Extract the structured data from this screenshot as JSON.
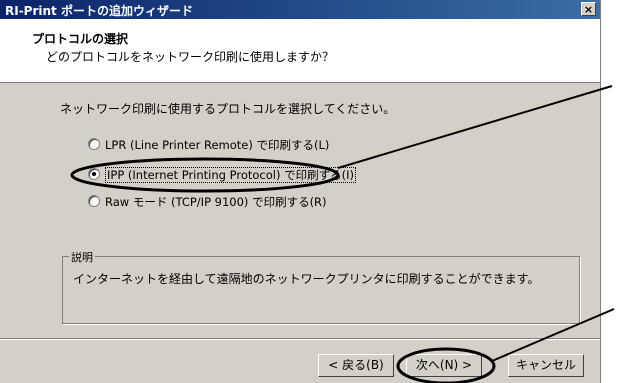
{
  "window": {
    "title": "RI-Print ポートの追加ウィザード",
    "close_label": "×"
  },
  "header": {
    "title": "プロトコルの選択",
    "subtitle": "どのプロトコルをネットワーク印刷に使用しますか？"
  },
  "main": {
    "intro": "ネットワーク印刷に使用するプロトコルを選択してください。",
    "options": [
      {
        "label": "LPR (Line Printer Remote) で印刷する(L)",
        "selected": false
      },
      {
        "label": "IPP (Internet Printing Protocol) で印刷する(I)",
        "selected": true
      },
      {
        "label": "Raw モード (TCP/IP 9100) で印刷する(R)",
        "selected": false
      }
    ],
    "description": {
      "legend": "説明",
      "text": "インターネットを経由して遠隔地のネットワークプリンタに印刷することができます。"
    }
  },
  "buttons": {
    "back": "< 戻る(B)",
    "next": "次へ(N) >",
    "cancel": "キャンセル"
  },
  "colors": {
    "dialog_bg": "#d4d0c8",
    "title_start": "#0a246a",
    "title_end": "#3a6ea5",
    "annotation": "#000000"
  }
}
